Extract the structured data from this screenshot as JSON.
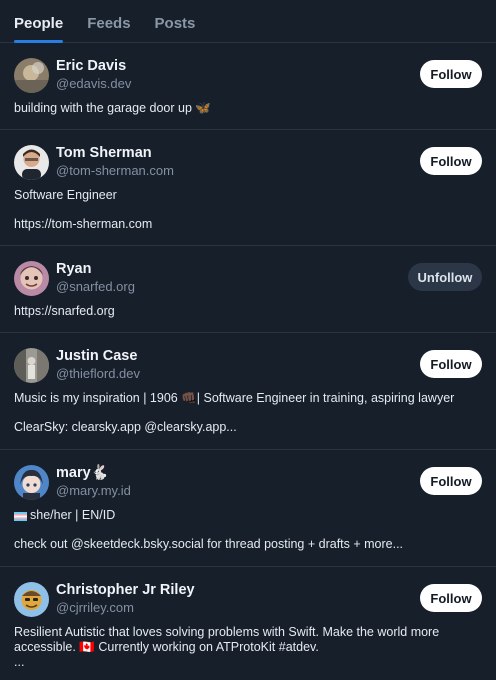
{
  "tabs": [
    "People",
    "Feeds",
    "Posts"
  ],
  "colors": {
    "accent": "#2a7de1",
    "background": "#171f2b"
  },
  "people": [
    {
      "name": "Eric Davis",
      "handle": "@edavis.dev",
      "button": "Follow",
      "bio": [
        "building with the garage door up 🦋"
      ]
    },
    {
      "name": "Tom Sherman",
      "handle": "@tom-sherman.com",
      "button": "Follow",
      "bio": [
        "Software Engineer",
        "https://tom-sherman.com"
      ]
    },
    {
      "name": "Ryan",
      "handle": "@snarfed.org",
      "button": "Unfollow",
      "bio": [
        "https://snarfed.org"
      ]
    },
    {
      "name": "Justin Case",
      "handle": "@thieflord.dev",
      "button": "Follow",
      "bio": [
        "Music is my inspiration | 1906 👊🏿| Software Engineer in training, aspiring lawyer",
        "ClearSky: clearsky.app @clearsky.app..."
      ]
    },
    {
      "name": "mary🐇",
      "handle": "@mary.my.id",
      "button": "Follow",
      "bio": [
        "she/her | EN/ID",
        "check out @skeetdeck.bsky.social for thread posting + drafts + more..."
      ]
    },
    {
      "name": "Christopher Jr Riley",
      "handle": "@cjrriley.com",
      "button": "Follow",
      "bio": [
        "Resilient Autistic that loves solving problems with Swift. Make the world more accessible. 🇨🇦 Currently working on ATProtoKit #atdev.",
        "..."
      ]
    }
  ]
}
